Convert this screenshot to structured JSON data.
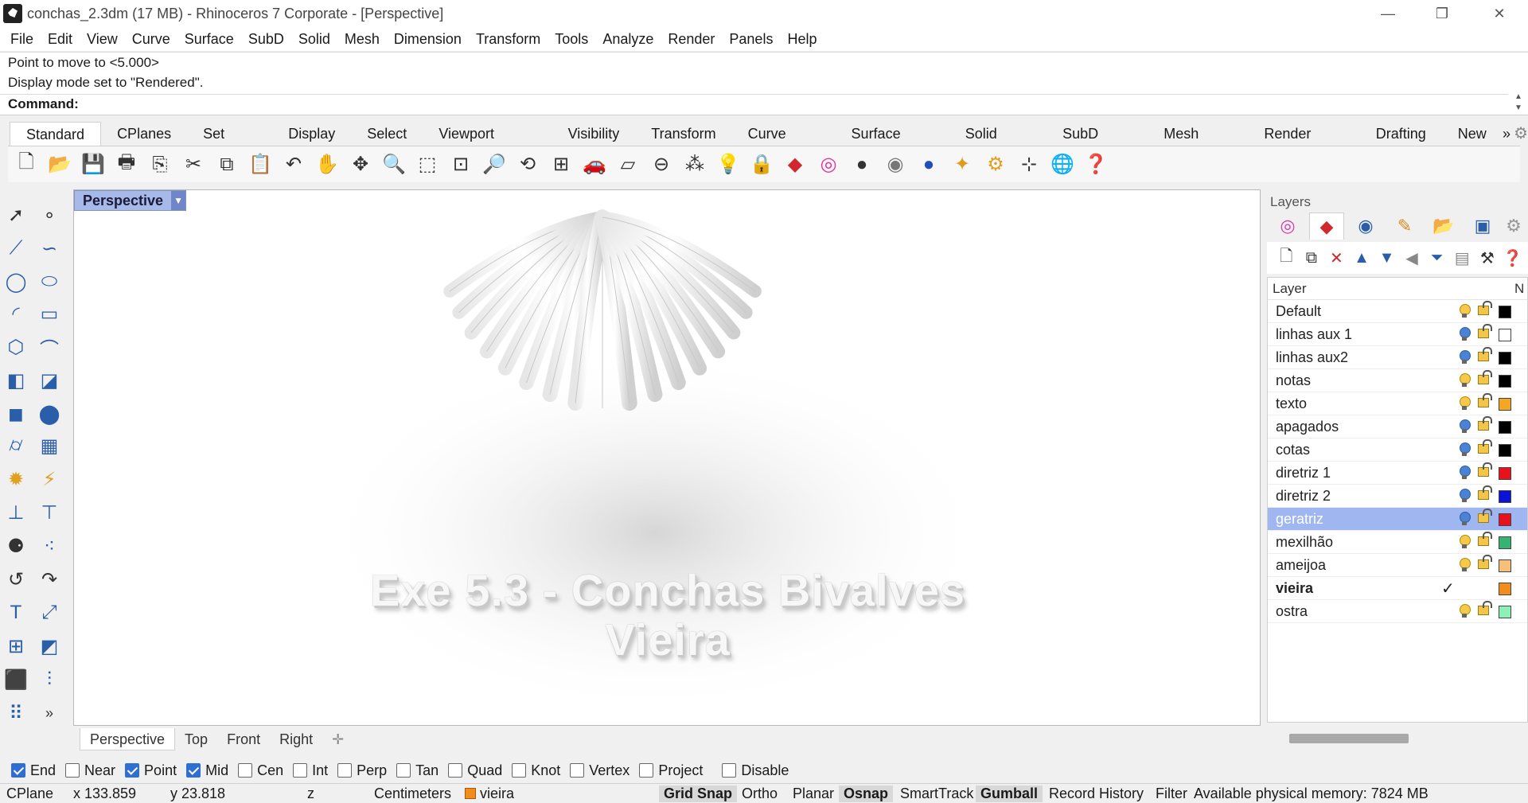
{
  "window": {
    "title": "conchas_2.3dm (17 MB) - Rhinoceros 7 Corporate - [Perspective]",
    "minimize": "—",
    "restore": "❐",
    "close": "✕"
  },
  "menu": [
    "File",
    "Edit",
    "View",
    "Curve",
    "Surface",
    "SubD",
    "Solid",
    "Mesh",
    "Dimension",
    "Transform",
    "Tools",
    "Analyze",
    "Render",
    "Panels",
    "Help"
  ],
  "command": {
    "history": [
      "Point to move to <5.000>",
      "Display mode set to \"Rendered\"."
    ],
    "prompt": "Command:"
  },
  "toolbar_tabs": [
    "Standard",
    "CPlanes",
    "Set View",
    "Display",
    "Select",
    "Viewport Layout",
    "Visibility",
    "Transform",
    "Curve Tools",
    "Surface Tools",
    "Solid Tools",
    "SubD Tools",
    "Mesh Tools",
    "Render Tools",
    "Drafting",
    "New in"
  ],
  "toolbar_more": "»",
  "viewport": {
    "label": "Perspective",
    "dropdown": "▼",
    "scene_text_line1": "Exe 5.3 - Conchas Bivalves",
    "scene_text_line2": "Vieira"
  },
  "viewport_tabs": [
    "Perspective",
    "Top",
    "Front",
    "Right"
  ],
  "viewport_add": "✛",
  "layers_panel": {
    "title": "Layers",
    "column_header": "Layer",
    "column_header_extra": "N",
    "layers": [
      {
        "name": "Default",
        "bulb": "on",
        "color": "#000000"
      },
      {
        "name": "linhas aux 1",
        "bulb": "off",
        "color": "#ffffff"
      },
      {
        "name": "linhas aux2",
        "bulb": "off",
        "color": "#000000"
      },
      {
        "name": "notas",
        "bulb": "on",
        "color": "#000000"
      },
      {
        "name": "texto",
        "bulb": "on",
        "color": "#f5a623"
      },
      {
        "name": "apagados",
        "bulb": "off",
        "color": "#000000"
      },
      {
        "name": "cotas",
        "bulb": "off",
        "color": "#000000"
      },
      {
        "name": "diretriz 1",
        "bulb": "off",
        "color": "#e8121c"
      },
      {
        "name": "diretriz 2",
        "bulb": "off",
        "color": "#0a14d8"
      },
      {
        "name": "geratriz",
        "bulb": "off",
        "color": "#e8121c",
        "selected": true
      },
      {
        "name": "mexilhão",
        "bulb": "on",
        "color": "#36b370"
      },
      {
        "name": "ameijoa",
        "bulb": "on",
        "color": "#f6c07a"
      },
      {
        "name": "vieira",
        "current": true,
        "color": "#f28c1c"
      },
      {
        "name": "ostra",
        "bulb": "on",
        "color": "#8ef0b6"
      }
    ],
    "current_mark": "✓"
  },
  "osnaps": [
    {
      "label": "End",
      "checked": true
    },
    {
      "label": "Near",
      "checked": false
    },
    {
      "label": "Point",
      "checked": true
    },
    {
      "label": "Mid",
      "checked": true
    },
    {
      "label": "Cen",
      "checked": false
    },
    {
      "label": "Int",
      "checked": false
    },
    {
      "label": "Perp",
      "checked": false
    },
    {
      "label": "Tan",
      "checked": false
    },
    {
      "label": "Quad",
      "checked": false
    },
    {
      "label": "Knot",
      "checked": false
    },
    {
      "label": "Vertex",
      "checked": false
    },
    {
      "label": "Project",
      "checked": false
    },
    {
      "label": "Disable",
      "checked": false
    }
  ],
  "status": {
    "cplane": "CPlane",
    "x": "x 133.859",
    "y": "y 23.818",
    "z": "z",
    "units": "Centimeters",
    "layer": "vieira",
    "grid_snap": "Grid Snap",
    "ortho": "Ortho",
    "planar": "Planar",
    "osnap": "Osnap",
    "smarttrack": "SmartTrack",
    "gumball": "Gumball",
    "record_history": "Record History",
    "filter": "Filter",
    "memory": "Available physical memory: 7824 MB"
  }
}
